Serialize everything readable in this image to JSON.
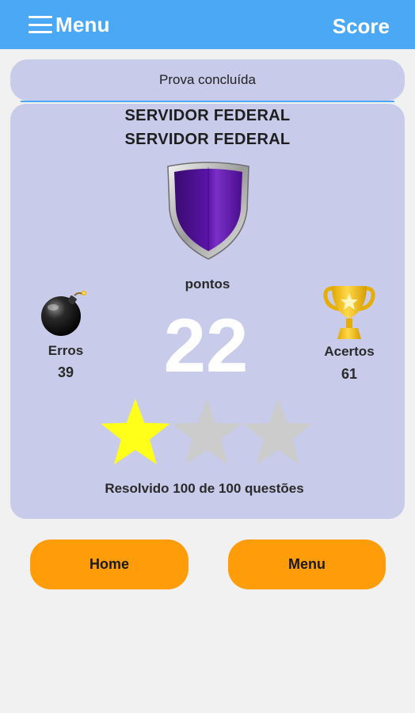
{
  "app_bar": {
    "menu_label": "Menu",
    "score_label": "Score",
    "background_color": "#4aa8f5"
  },
  "status": {
    "text": "Prova concluída"
  },
  "result": {
    "title_line_1": "SERVIDOR FEDERAL",
    "title_line_2": "SERVIDOR FEDERAL",
    "badge": "purple-shield",
    "points_label": "pontos",
    "points_value": "22",
    "errors": {
      "label": "Erros",
      "value": "39",
      "icon": "bomb-icon"
    },
    "hits": {
      "label": "Acertos",
      "value": "61",
      "icon": "trophy-icon"
    },
    "stars": {
      "earned": 1,
      "total": 3,
      "filled_color": "#ffff1a",
      "empty_color": "#cccccc"
    },
    "resolved_text": "Resolvido 100 de 100 questões"
  },
  "buttons": {
    "home": "Home",
    "menu": "Menu",
    "color": "#ff9c0a"
  }
}
